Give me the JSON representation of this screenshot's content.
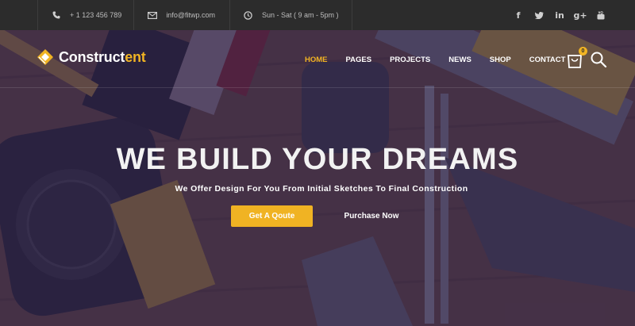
{
  "topbar": {
    "phone": {
      "icon": "phone-icon",
      "text": "+ 1 123 456 789"
    },
    "email": {
      "icon": "mail-icon",
      "text": "info@fitwp.com"
    },
    "hours": {
      "icon": "clock-icon",
      "text": "Sun - Sat ( 9 am - 5pm )"
    },
    "socials": [
      {
        "icon": "facebook-icon",
        "glyph": "f"
      },
      {
        "icon": "twitter-icon",
        "glyph": "t"
      },
      {
        "icon": "linkedin-icon",
        "glyph": "in"
      },
      {
        "icon": "google-plus-icon",
        "glyph": "g+"
      },
      {
        "icon": "youtube-icon",
        "glyph": "▶"
      }
    ]
  },
  "brand": {
    "name_main": "Construct",
    "name_accent": "ent",
    "accent_color": "#f0b323"
  },
  "nav": {
    "items": [
      {
        "label": "HOME",
        "active": true
      },
      {
        "label": "PAGES",
        "active": false
      },
      {
        "label": "PROJECTS",
        "active": false
      },
      {
        "label": "NEWS",
        "active": false
      },
      {
        "label": "SHOP",
        "active": false
      },
      {
        "label": "CONTACT",
        "active": false
      }
    ],
    "cart_count": "0"
  },
  "hero": {
    "headline": "WE BUILD YOUR DREAMS",
    "subheadline": "We Offer Design For You From Initial Sketches To Final Construction",
    "primary_button": "Get A Qoute",
    "secondary_button": "Purchase Now"
  }
}
